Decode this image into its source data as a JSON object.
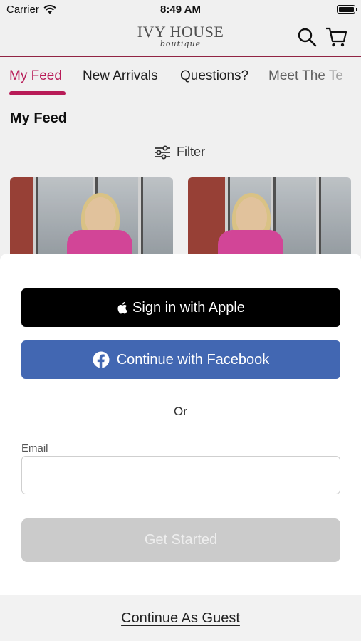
{
  "status_bar": {
    "carrier": "Carrier",
    "time": "8:49 AM"
  },
  "header": {
    "logo_main": "IVY HOUSE",
    "logo_sub": "boutique",
    "icons": [
      "search-icon",
      "cart-icon"
    ]
  },
  "tabs": [
    {
      "label": "My Feed",
      "active": true
    },
    {
      "label": "New Arrivals",
      "active": false
    },
    {
      "label": "Questions?",
      "active": false
    },
    {
      "label": "Meet The Te",
      "active": false
    }
  ],
  "feed": {
    "title": "My Feed",
    "filter_label": "Filter"
  },
  "sheet": {
    "apple_button": "Sign in with Apple",
    "facebook_button": "Continue with Facebook",
    "or_text": "Or",
    "email_label": "Email",
    "email_value": "",
    "email_placeholder": "",
    "start_button": "Get Started",
    "guest_link": "Continue As Guest"
  },
  "colors": {
    "accent": "#c41d5d",
    "header_line": "#9b2749",
    "facebook": "#4267b2",
    "apple": "#000000",
    "disabled_button": "#cbcbcb"
  }
}
